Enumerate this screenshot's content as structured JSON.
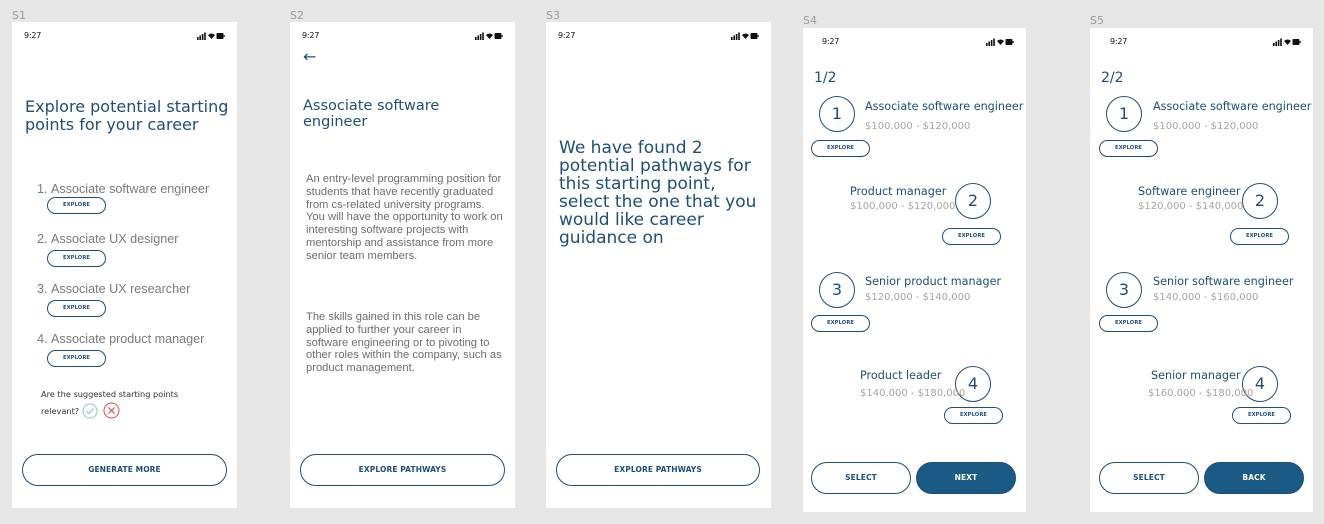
{
  "status_time": "9:27",
  "s1": {
    "label": "S1",
    "title": "Explore potential starting points for your career",
    "items": [
      {
        "num": "1.",
        "text": "Associate software engineer"
      },
      {
        "num": "2.",
        "text": "Associate UX designer"
      },
      {
        "num": "3.",
        "text": "Associate UX researcher"
      },
      {
        "num": "4.",
        "text": "Associate product manager"
      }
    ],
    "explore_label": "EXPLORE",
    "relevance_line1": "Are the suggested starting points",
    "relevance_line2": "relevant?",
    "generate_label": "GENERATE MORE"
  },
  "s2": {
    "label": "S2",
    "back_arrow": "←",
    "title": "Associate software engineer",
    "paragraph1": "An entry-level programming position for students that have recently graduated from cs-related university programs. You will have the opportunity to work on interesting software projects with mentorship and assistance from more senior team members.",
    "paragraph2": "The skills gained in this role can be applied to further your career in software engineering or to pivoting to other roles within the company, such as product management.",
    "button_label": "EXPLORE PATHWAYS"
  },
  "s3": {
    "label": "S3",
    "message": "We have found 2 potential pathways for this starting point, select the one that you would like career guidance on",
    "button_label": "EXPLORE PATHWAYS"
  },
  "s4": {
    "label": "S4",
    "page": "1/2",
    "steps": [
      {
        "n": "1",
        "title": "Associate software engineer",
        "salary": "$100,000 - $120,000"
      },
      {
        "n": "2",
        "title": "Product manager",
        "salary": "$100,000 - $120,000"
      },
      {
        "n": "3",
        "title": "Senior product manager",
        "salary": "$120,000 - $140,000"
      },
      {
        "n": "4",
        "title": "Product leader",
        "salary": "$140,000 - $180,000"
      }
    ],
    "explore_label": "EXPLORE",
    "select_label": "SELECT",
    "next_label": "NEXT"
  },
  "s5": {
    "label": "S5",
    "page": "2/2",
    "steps": [
      {
        "n": "1",
        "title": "Associate software engineer",
        "salary": "$100,000 - $120,000"
      },
      {
        "n": "2",
        "title": "Software engineer",
        "salary": "$120,000 - $140,000"
      },
      {
        "n": "3",
        "title": "Senior software engineer",
        "salary": "$140,000 - $160,000"
      },
      {
        "n": "4",
        "title": "Senior manager",
        "salary": "$160,000 - $180,000"
      }
    ],
    "explore_label": "EXPLORE",
    "select_label": "SELECT",
    "back_label": "BACK"
  },
  "colors": {
    "primary": "#1c4f7c",
    "button_fill": "#1c5a86",
    "check_green": "#7fd4b0",
    "cross_red": "#e2464a",
    "background": "#e6e6e6"
  },
  "icons": [
    "signal-icon",
    "wifi-icon",
    "battery-icon",
    "back-arrow-icon",
    "check-icon",
    "cross-icon"
  ]
}
